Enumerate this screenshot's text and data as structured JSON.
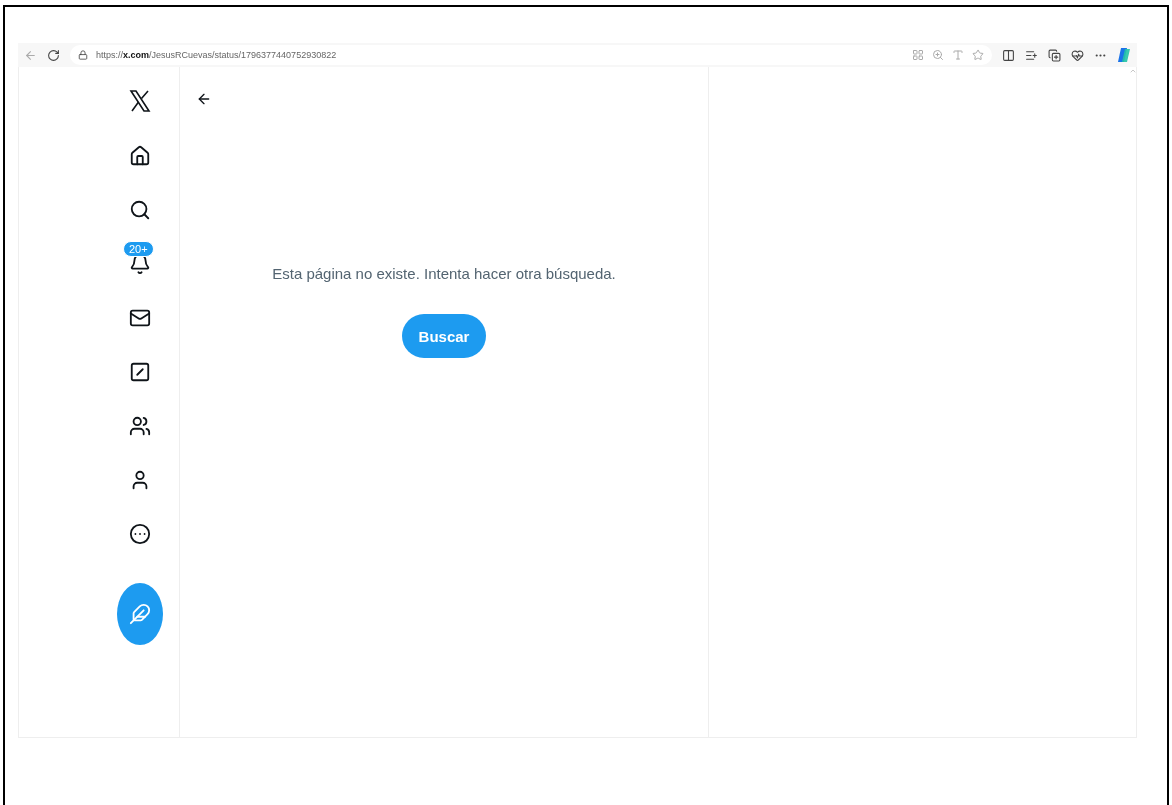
{
  "browser": {
    "url": "https://**x.com**/JesusRCuevas/status/1796377440752930822"
  },
  "sidebar": {
    "items": [
      {
        "kind": "home"
      },
      {
        "kind": "explore"
      },
      {
        "kind": "notifications",
        "badge": "20+"
      },
      {
        "kind": "messages"
      },
      {
        "kind": "grok"
      },
      {
        "kind": "communities"
      },
      {
        "kind": "profile"
      },
      {
        "kind": "more"
      }
    ]
  },
  "main": {
    "message": "Esta página no existe. Intenta hacer otra búsqueda.",
    "button": "Buscar"
  }
}
